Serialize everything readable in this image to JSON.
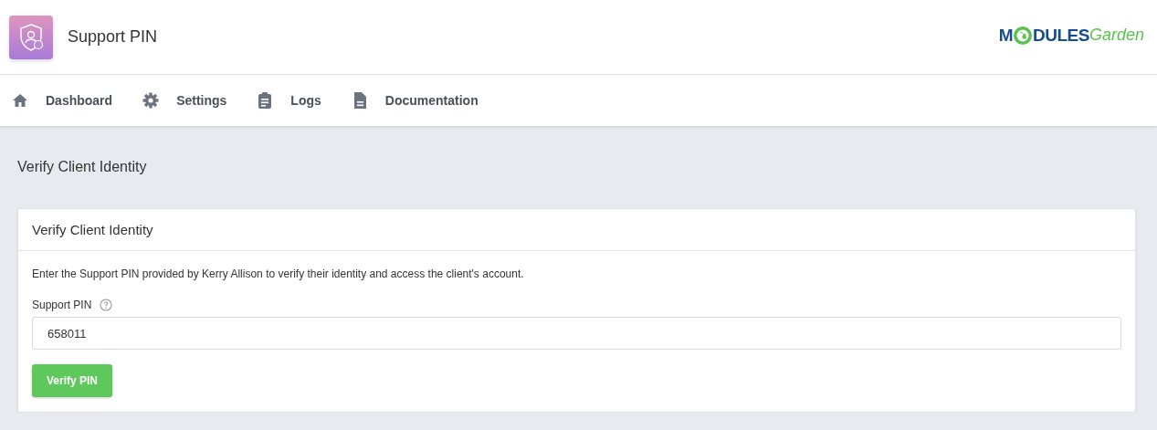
{
  "header": {
    "title": "Support PIN",
    "logo": {
      "first": "M",
      "middle": "DULES",
      "last": "Garden"
    }
  },
  "nav": [
    {
      "label": "Dashboard",
      "kind": "home"
    },
    {
      "label": "Settings",
      "kind": "gear"
    },
    {
      "label": "Logs",
      "kind": "clipboard"
    },
    {
      "label": "Documentation",
      "kind": "document"
    }
  ],
  "page_title": "Verify Client Identity",
  "card": {
    "title": "Verify Client Identity",
    "description": "Enter the Support PIN provided by Kerry Allison to verify their identity and access the client's account.",
    "field": {
      "label": "Support PIN",
      "value": "658011"
    },
    "button": "Verify PIN"
  }
}
